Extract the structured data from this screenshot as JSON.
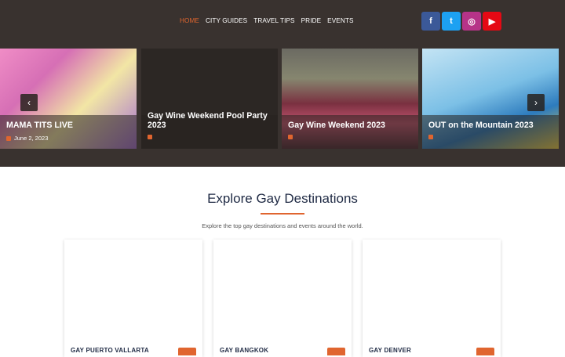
{
  "nav": {
    "items": [
      {
        "label": "HOME",
        "active": true
      },
      {
        "label": "CITY GUIDES",
        "active": false
      },
      {
        "label": "TRAVEL TIPS",
        "active": false
      },
      {
        "label": "PRIDE",
        "active": false
      },
      {
        "label": "EVENTS",
        "active": false
      }
    ]
  },
  "socials": {
    "facebook": "f",
    "twitter": "t",
    "instagram": "◎",
    "youtube": "▶"
  },
  "slider": {
    "slides": [
      {
        "title": "MAMA TITS LIVE",
        "date": "June 2, 2023"
      },
      {
        "title": "Gay Wine Weekend Pool Party 2023",
        "date": ""
      },
      {
        "title": "Gay Wine Weekend 2023",
        "date": ""
      },
      {
        "title": "OUT on the Mountain 2023",
        "date": ""
      }
    ],
    "prev_icon": "‹",
    "next_icon": "›"
  },
  "section": {
    "title": "Explore Gay Destinations",
    "subtitle": "Explore the top gay destinations and events around the world."
  },
  "cards": [
    {
      "name": "GAY PUERTO VALLARTA"
    },
    {
      "name": "GAY BANGKOK"
    },
    {
      "name": "GAY DENVER"
    }
  ],
  "colors": {
    "accent": "#e0652f",
    "header_bg": "#39322f",
    "heading": "#1f2a44"
  }
}
